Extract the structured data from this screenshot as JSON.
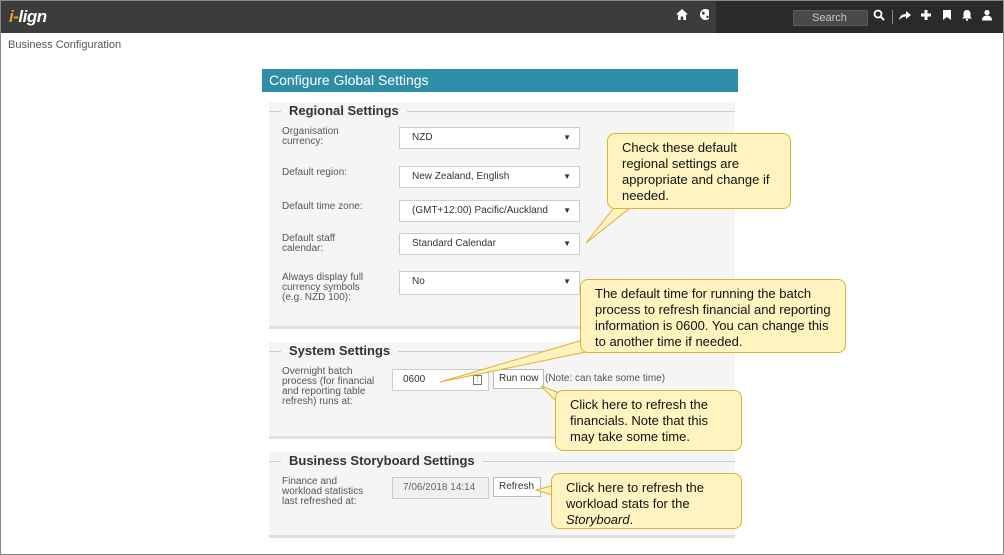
{
  "app": {
    "logo_prefix": "i-",
    "logo_main": "lign"
  },
  "topbar": {
    "icons": [
      "home-icon",
      "globe-icon",
      "search-icon",
      "share-icon",
      "plus-icon",
      "bookmark-icon",
      "bell-icon",
      "user-icon"
    ],
    "search_placeholder": "Search"
  },
  "breadcrumb": "Business Configuration",
  "panel": {
    "title": "Configure Global Settings",
    "regional": {
      "title": "Regional Settings",
      "currency_label": "Organisation currency:",
      "currency_value": "NZD",
      "region_label": "Default region:",
      "region_value": "New Zealand, English",
      "timezone_label": "Default time zone:",
      "timezone_value": "(GMT+12:00) Pacific/Auckland",
      "calendar_label": "Default staff calendar:",
      "calendar_value": "Standard Calendar",
      "symbols_label": "Always display full currency symbols (e.g. NZD 100):",
      "symbols_value": "No"
    },
    "system": {
      "title": "System Settings",
      "batch_label": "Overnight batch process (for financial and reporting table refresh) runs at:",
      "batch_value": "0600",
      "run_now_label": "Run now",
      "note": "(Note: can take some time)"
    },
    "storyboard": {
      "title": "Business Storyboard Settings",
      "refreshed_label": "Finance and workload statistics last refreshed at:",
      "refreshed_value": "7/06/2018 14:14",
      "refresh_label": "Refresh"
    }
  },
  "callouts": {
    "regional": "Check these default regional settings are appropriate and change if needed.",
    "batch": "The default time for running the batch process to refresh financial and reporting information is 0600. You can change this to another time if needed.",
    "run_now": "Click here to refresh the financials. Note that this may take some time.",
    "refresh_pre": "Click here to refresh the workload stats for the ",
    "refresh_em": "Storyboard",
    "refresh_post": "."
  },
  "colors": {
    "header": "#2e8ea8",
    "topbar": "#3c3c3c",
    "callout_bg": "#fff3c0",
    "callout_border": "#e0b030"
  }
}
